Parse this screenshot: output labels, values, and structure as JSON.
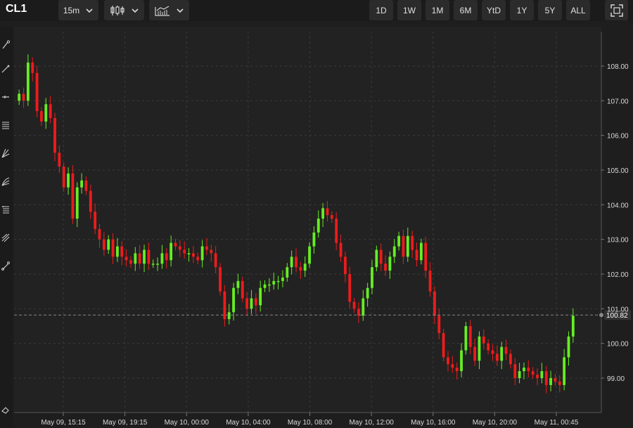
{
  "symbol": "CL1",
  "interval": "15m",
  "ranges": [
    "1D",
    "1W",
    "1M",
    "6M",
    "YtD",
    "1Y",
    "5Y",
    "ALL"
  ],
  "icons": {
    "chart_type": "candlestick-icon",
    "indicators": "indicators-icon",
    "fullscreen": "fullscreen-icon",
    "tools": [
      "brush-tool-icon",
      "trend-line-icon",
      "horizontal-line-icon",
      "fib-retracement-icon",
      "pitchfork-icon",
      "fib-fan-icon",
      "fib-channel-icon",
      "fib-extension-icon",
      "measure-tool-icon",
      "eraser-icon"
    ]
  },
  "colors": {
    "up": "#66ee22",
    "down": "#ee1b1b",
    "background": "#222222",
    "grid": "#3a3a3a",
    "last_price_line": "#888888"
  },
  "chart_data": {
    "type": "candlestick",
    "ylim": [
      98.0,
      109.0
    ],
    "y_ticks": [
      "108.00",
      "107.00",
      "106.00",
      "105.00",
      "104.00",
      "103.00",
      "102.00",
      "101.00",
      "100.00",
      "99.00"
    ],
    "x_tick_labels": [
      "May 09, 15:15",
      "May 09, 19:15",
      "May 10, 00:00",
      "May 10, 04:00",
      "May 10, 08:00",
      "May 10, 12:00",
      "May 10, 16:00",
      "May 10, 20:00",
      "May 11, 00:45"
    ],
    "last_price": "100.82",
    "grid": true,
    "close": [
      107.2,
      107.0,
      108.1,
      107.8,
      106.7,
      106.4,
      106.9,
      106.5,
      105.5,
      105.1,
      104.5,
      104.9,
      103.6,
      104.5,
      104.7,
      104.4,
      103.8,
      103.3,
      103.0,
      102.7,
      103.0,
      102.5,
      102.8,
      102.5,
      102.4,
      102.3,
      102.6,
      102.3,
      102.7,
      102.3,
      102.3,
      102.3,
      102.6,
      102.4,
      102.9,
      102.8,
      102.7,
      102.6,
      102.6,
      102.5,
      102.4,
      102.8,
      102.7,
      102.6,
      102.2,
      101.5,
      100.7,
      100.9,
      101.6,
      101.8,
      101.3,
      101.0,
      101.3,
      101.1,
      101.6,
      101.7,
      101.7,
      101.8,
      101.8,
      101.9,
      102.2,
      102.5,
      102.2,
      102.1,
      102.3,
      102.8,
      103.2,
      103.6,
      103.9,
      103.7,
      103.6,
      102.9,
      102.5,
      102.0,
      101.2,
      101.0,
      100.8,
      101.3,
      101.6,
      102.2,
      102.7,
      102.3,
      102.1,
      102.5,
      102.8,
      103.1,
      102.5,
      103.1,
      102.7,
      102.4,
      102.9,
      102.1,
      101.5,
      100.8,
      100.3,
      99.6,
      99.4,
      99.3,
      99.2,
      99.8,
      100.5,
      99.9,
      99.5,
      100.2,
      100.0,
      99.8,
      99.7,
      99.5,
      99.9,
      99.7,
      99.4,
      99.0,
      99.2,
      99.3,
      99.2,
      99.1,
      99.0,
      99.2,
      98.8,
      99.0,
      98.9,
      98.8,
      99.6,
      100.2,
      100.8
    ]
  }
}
